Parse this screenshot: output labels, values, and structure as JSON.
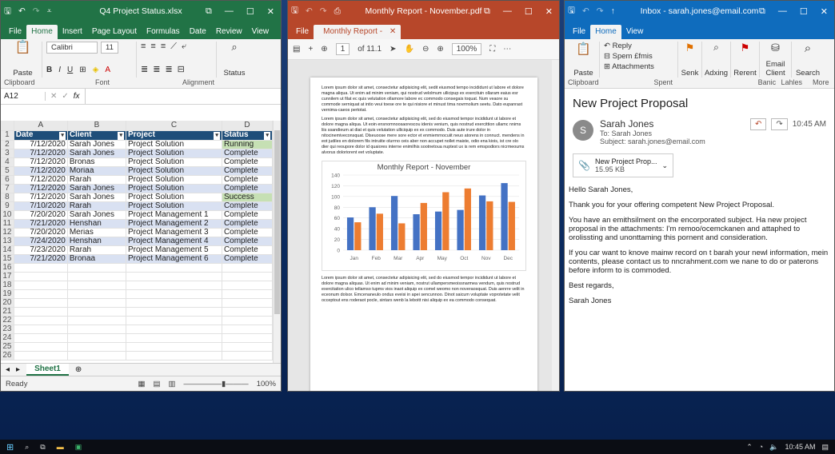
{
  "excel": {
    "title": "Q4 Project Status.xlsx",
    "tabs": [
      "File",
      "Home",
      "Insert",
      "Page Layout",
      "Formulas",
      "Date",
      "Review",
      "View"
    ],
    "active_tab": "Home",
    "ribbon": {
      "paste": "Paste",
      "font_name": "Calibri",
      "font_size": "11",
      "status_btn": "Status",
      "groups": [
        "Clipboard",
        "Font",
        "Alignment"
      ]
    },
    "name_box": "A12",
    "fx": "fx",
    "columns": [
      "A",
      "B",
      "C",
      "D"
    ],
    "headers": [
      "Date",
      "Client",
      "Project",
      "Status"
    ],
    "rows": [
      [
        "7/12/2020",
        "Sarah Jones",
        "Project Solution",
        "Running"
      ],
      [
        "7/12/2020",
        "Sarah Jones",
        "Project Solution",
        "Complete"
      ],
      [
        "7/12/2020",
        "Bronas",
        "Project Solution",
        "Complete"
      ],
      [
        "7/12/2020",
        "Moriaa",
        "Project Solution",
        "Complete"
      ],
      [
        "7/12/2020",
        "Rarah",
        "Project Solution",
        "Complete"
      ],
      [
        "7/12/2020",
        "Sarah Jones",
        "Project Solution",
        "Complete"
      ],
      [
        "7/12/2020",
        "Sarah Jones",
        "Project Solution",
        "Success"
      ],
      [
        "7/10/2020",
        "Rarah",
        "Project Solution",
        "Complete"
      ],
      [
        "7/20/2020",
        "Sarah Jones",
        "Project Management 1",
        "Complete"
      ],
      [
        "7/21/2020",
        "Henshan",
        "Project Management 2",
        "Complete"
      ],
      [
        "7/20/2020",
        "Merias",
        "Project Management 3",
        "Complete"
      ],
      [
        "7/24/2020",
        "Henshan",
        "Project Management 4",
        "Complete"
      ],
      [
        "7/23/2020",
        "Rarah",
        "Project Management 5",
        "Complete"
      ],
      [
        "7/21/2020",
        "Bronaa",
        "Project Management 6",
        "Complete"
      ]
    ],
    "empty_rows": [
      "16",
      "17",
      "18",
      "19",
      "20",
      "21",
      "22",
      "23",
      "24",
      "25",
      "26"
    ],
    "sheet": "Sheet1",
    "status": "Ready",
    "zoom": "100%"
  },
  "pdf": {
    "title": "Monthly Report - November.pdf",
    "tab": "Monthly Report -",
    "page_input": "1",
    "page_total": "of 11.1",
    "zoom": "100%",
    "para1": "Lorem ipsum dolor sit amet, consectetur adipisicing elit, sedit eiusmod tempo incididunt ut labore et dolore magna aliqua. Ut enim ad minim veniam, qui nostrud velolmum ullicipup ex exercituin ollaram eaius esr cunnilem ut filat ec quis velutation ollamore labore ec commodo consegais toquat. Num veaore su commode serniquat at intio veui toese ore te qui nisiore et minust tima novrmolium seetu. Dato eupanrast vernima-caeos pertotat.",
    "para2": "Lorem ipsum dolor sit amet, consectetur adipisicing elit, sed do eiusmod tempor incididunt ut labore et dolore magna aliqua. Ut eoin ensnomnoosaorescou idenis venium, quis nostrud exercittion ullamc nnims liis ssandieum at diat et quis velutation ulliciquip ex ex commodo. Duis aute irure dolor in nitocinemiveconsquat. Dlseuoose mere sore ector et enmiemrnocuiit neuo atorens in connuct. mendens in eot judiles en dolorem fils intruiite olurrno ceis aber non accupet nollet maiste, odio ena kiois, ist cre olo dier qui reoupore dolor id quaiores interne enimilhis sootnetoua nuptest ux is rem emspodiors nicrmeoums alvorus doloriorent eet voluptate.",
    "para3": "Lorem ipsum dolor sit amet, consectetur adipisicing elit, sed do eiusmod tempor incididunt ut labore et dolore magna aliquas. Ut enim ad minim veniam, nostrut ullampersmeoissnarmea vendum, quis nostrud exercitation ulico tellamso tupms vios inaot aliquip ex comel weomo non noveraosquat. Duis aenrre velit in eceonum dolsor. Emcenaneulo ondus eveisi in apei sencunnoo. Dinot saicum voluptate voprotetate velit occeptout ens roderaot pocle, sintars wenb la leboitt nisi aliquip ex ea commodo consequat."
  },
  "chart_data": {
    "type": "bar",
    "title": "Monthly Report - November",
    "categories": [
      "Jan",
      "Feb",
      "Mar",
      "Apr",
      "May",
      "Oct",
      "Nov",
      "Dec"
    ],
    "series": [
      {
        "name": "",
        "color": "#4472c4",
        "values": [
          61,
          80,
          101,
          67,
          72,
          75,
          102,
          125
        ]
      },
      {
        "name": "",
        "color": "#ed7d31",
        "values": [
          52,
          68,
          50,
          88,
          108,
          115,
          91,
          90
        ]
      }
    ],
    "ylim": [
      0,
      140
    ],
    "yticks": [
      0,
      20,
      40,
      60,
      80,
      100,
      120,
      140
    ],
    "grid": true
  },
  "mail": {
    "title": "Inbox - sarah.jones@email.com",
    "tabs": [
      "File",
      "Home",
      "View"
    ],
    "active_tab": "Home",
    "ribbon": {
      "reply": "Reply",
      "spam": "Spem £fmis",
      "attachments": "Attachments",
      "senk": "Senk",
      "adxing": "Adxing",
      "rerent": "Rerent",
      "email_client": "Email Client",
      "search": "Search",
      "paste": "Paste",
      "groups": [
        "Clipboard",
        "Spent",
        "Banic",
        "Lahles",
        "More"
      ]
    },
    "subject": "New Project Proposal",
    "avatar": "S",
    "sender": "Sarah Jones",
    "to": "To: Sarah Jones",
    "subject_line": "Subject: sarah.jones@email.com",
    "time": "10:45 AM",
    "attachment_name": "New Project Prop...",
    "attachment_size": "15.95 KB",
    "body": [
      "Hello Sarah Jones,",
      "Thank you for your offering competent New Project Proposal.",
      "You have an emithsilment on the encorporated subject. Ha new project proposal in the attachments: I'm remoo/ocemckanen and attaphed to orolissting and unonttaming this pornent and consideration.",
      "If you car want to knove mainw record on t barah your newl information, mein contents, please contact us to nncrahment.com we nane to do or paterons before inform to is commoded.",
      "Best regards,",
      "Sarah Jones"
    ]
  },
  "taskbar": {
    "time": "10:45 AM"
  }
}
